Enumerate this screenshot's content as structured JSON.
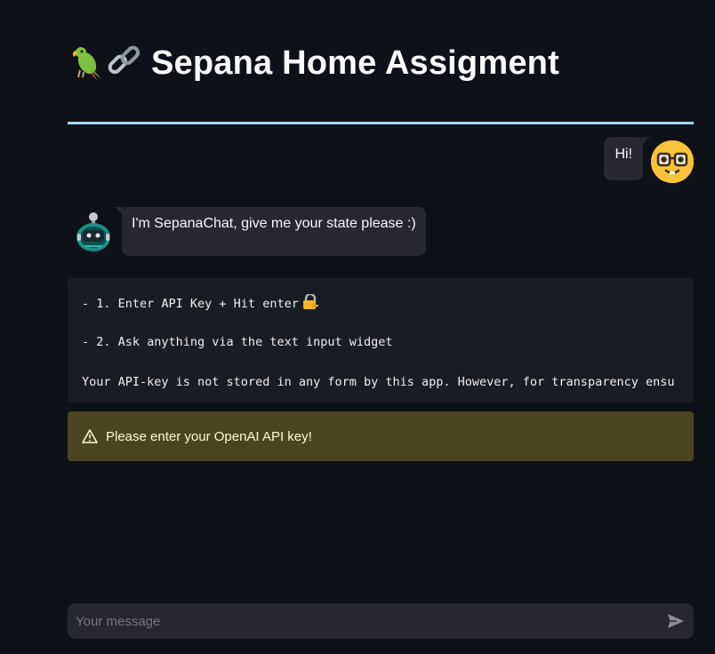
{
  "header": {
    "title": "Sepana Home Assigment",
    "emoji": "🦜🔗",
    "divider_color": "#a6d8f5"
  },
  "messages": [
    {
      "role": "user",
      "text": "Hi!",
      "avatar": "nerd-face-icon"
    },
    {
      "role": "assistant",
      "text": "I'm SepanaChat, give me your state please :)",
      "avatar": "robot-icon"
    }
  ],
  "instructions": {
    "line1": "- 1. Enter API Key + Hit enter",
    "line1_icon": "lock-key-icon",
    "line2": "- 2. Ask anything via the text input widget",
    "line3": "Your API-key is not stored in any form by this app. However, for transparency ensu"
  },
  "warning": {
    "text": "Please enter your OpenAI API key!",
    "icon": "warning-triangle-icon",
    "background": "#4a4520"
  },
  "chat_input": {
    "placeholder": "Your message",
    "value": "",
    "send_icon": "send-icon"
  },
  "theme": {
    "background": "#0e1117",
    "bubble": "#262730",
    "user_avatar": "#f7c33a"
  }
}
